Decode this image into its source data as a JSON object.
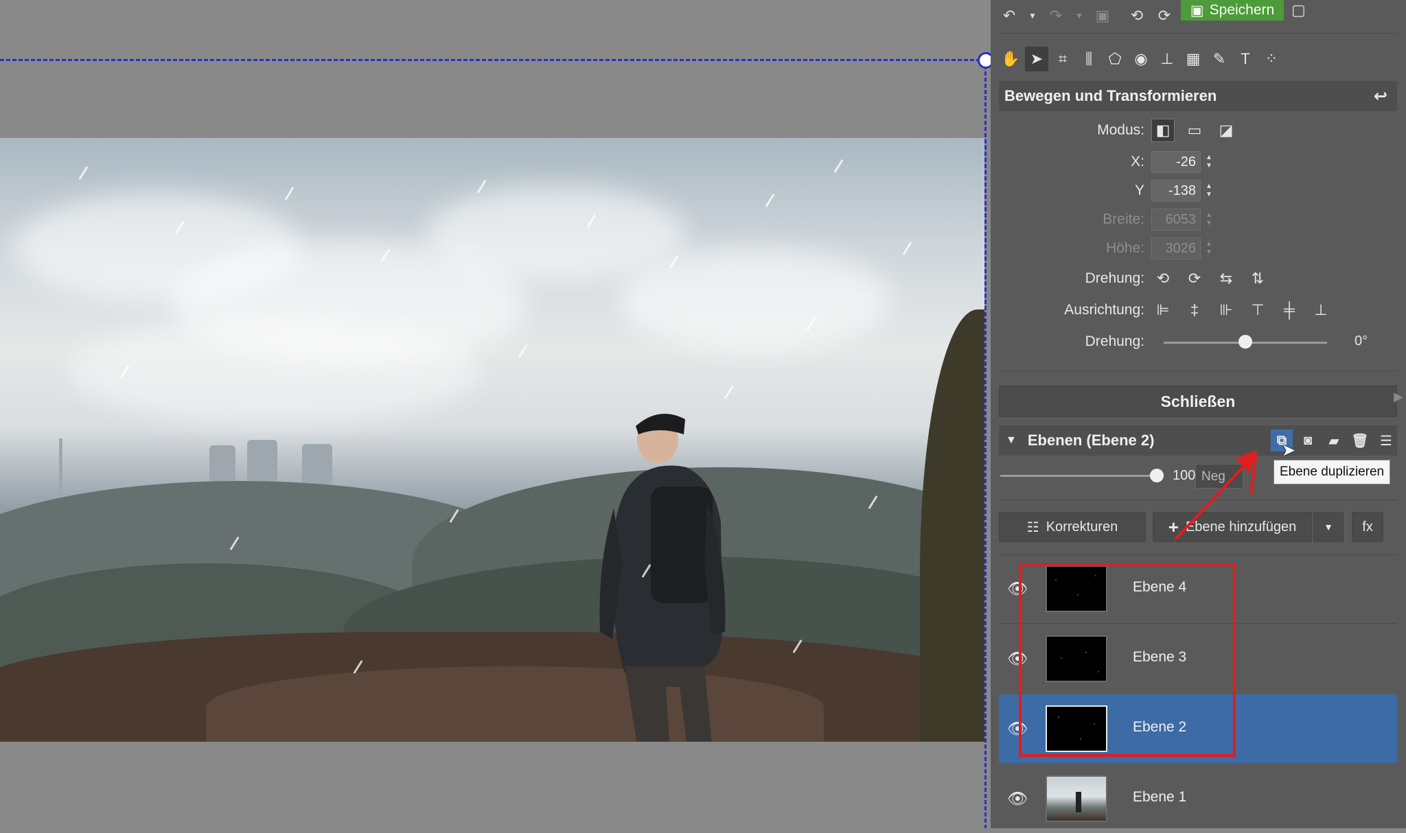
{
  "toolbar": {
    "save_label": "Speichern",
    "icons": [
      "undo-icon",
      "dropdown-icon",
      "redo-icon",
      "dropdown-icon",
      "image-icon",
      "rotate-left-icon",
      "rotate-right-icon",
      "save-icon",
      "save-as-icon"
    ]
  },
  "tools": [
    "hand-icon",
    "pointer-icon",
    "crop-icon",
    "straighten-icon",
    "perspective-icon",
    "red-eye-icon",
    "stamp-icon",
    "grid-icon",
    "brush-icon",
    "text-icon",
    "more-icon"
  ],
  "transform": {
    "title": "Bewegen und Transformieren",
    "mode_label": "Modus:",
    "x_label": "X:",
    "x_value": "-26",
    "y_label": "Y",
    "y_value": "-138",
    "width_label": "Breite:",
    "width_value": "6053",
    "height_label": "Höhe:",
    "height_value": "3026",
    "rotate_label": "Drehung:",
    "align_label": "Ausrichtung:",
    "angle_label": "Drehung:",
    "angle_value": "0°",
    "angle_fraction": 0.5,
    "close_label": "Schließen"
  },
  "layers": {
    "title": "Ebenen (Ebene 2)",
    "opacity_value": "100%",
    "opacity_fraction": 1.0,
    "blend_mode": "Neg",
    "tooltip": "Ebene duplizieren",
    "corrections_label": "Korrekturen",
    "add_layer_label": "Ebene hinzufügen",
    "fx_label": "fx",
    "items": [
      {
        "name": "Ebene 4",
        "selected": false
      },
      {
        "name": "Ebene 3",
        "selected": false
      },
      {
        "name": "Ebene 2",
        "selected": true
      },
      {
        "name": "Ebene 1",
        "selected": false
      }
    ]
  },
  "colors": {
    "accent": "#3c6ba5",
    "save": "#4d9b3a",
    "annotation": "#e21d1d",
    "selection": "#2b2fc8"
  }
}
